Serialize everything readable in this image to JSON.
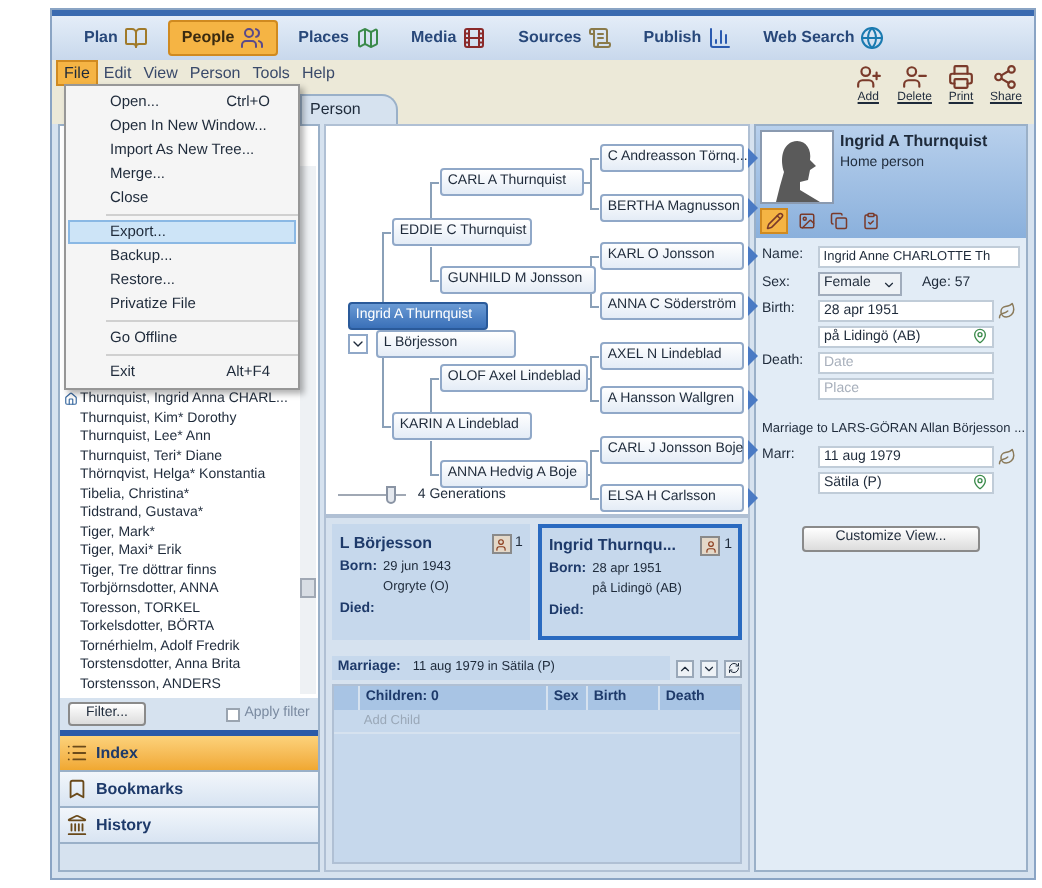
{
  "nav": [
    {
      "label": "Plan",
      "selected": false
    },
    {
      "label": "People",
      "selected": true
    },
    {
      "label": "Places",
      "selected": false
    },
    {
      "label": "Media",
      "selected": false
    },
    {
      "label": "Sources",
      "selected": false
    },
    {
      "label": "Publish",
      "selected": false
    },
    {
      "label": "Web Search",
      "selected": false
    }
  ],
  "menu": [
    {
      "label": "File",
      "selected": true
    },
    {
      "label": "Edit",
      "selected": false
    },
    {
      "label": "View",
      "selected": false
    },
    {
      "label": "Person",
      "selected": false
    },
    {
      "label": "Tools",
      "selected": false
    },
    {
      "label": "Help",
      "selected": false
    }
  ],
  "toolbar": [
    "Add",
    "Delete",
    "Print",
    "Share"
  ],
  "tab": "Person",
  "file_menu": [
    {
      "kind": "item",
      "label": "Open...",
      "shortcut": "Ctrl+O",
      "selected": false
    },
    {
      "kind": "item",
      "label": "Open In New Window...",
      "selected": false
    },
    {
      "kind": "item",
      "label": "Import As New Tree...",
      "selected": false
    },
    {
      "kind": "item",
      "label": "Merge...",
      "selected": false
    },
    {
      "kind": "item",
      "label": "Close",
      "selected": false
    },
    {
      "kind": "separator"
    },
    {
      "kind": "item",
      "label": "Export...",
      "selected": true
    },
    {
      "kind": "item",
      "label": "Backup...",
      "selected": false
    },
    {
      "kind": "item",
      "label": "Restore...",
      "selected": false
    },
    {
      "kind": "item",
      "label": "Privatize File",
      "selected": false
    },
    {
      "kind": "separator"
    },
    {
      "kind": "item",
      "label": "Go Offline",
      "selected": false
    },
    {
      "kind": "separator"
    },
    {
      "kind": "item",
      "label": "Exit",
      "shortcut": "Alt+F4",
      "selected": false
    }
  ],
  "index_list": [
    {
      "name": "Thurnquist, Ingrid Anna CHARL...",
      "home": true
    },
    {
      "name": "Thurnquist, Kim* Dorothy",
      "home": false
    },
    {
      "name": "Thurnquist, Lee* Ann",
      "home": false
    },
    {
      "name": "Thurnquist, Teri* Diane",
      "home": false
    },
    {
      "name": "Thörnqvist, Helga* Konstantia",
      "home": false
    },
    {
      "name": "Tibelia, Christina*",
      "home": false
    },
    {
      "name": "Tidstrand, Gustava*",
      "home": false
    },
    {
      "name": "Tiger, Mark*",
      "home": false
    },
    {
      "name": "Tiger, Maxi* Erik",
      "home": false
    },
    {
      "name": "Tiger, Tre döttrar finns",
      "home": false
    },
    {
      "name": "Torbjörnsdotter, ANNA",
      "home": false
    },
    {
      "name": "Toresson, TORKEL",
      "home": false
    },
    {
      "name": "Torkelsdotter, BÖRTA",
      "home": false
    },
    {
      "name": "Tornérhielm, Adolf Fredrik",
      "home": false
    },
    {
      "name": "Torstensdotter, Anna Brita",
      "home": false
    },
    {
      "name": "Torstensson, ANDERS",
      "home": false
    }
  ],
  "filter_button": "Filter...",
  "apply_filter": {
    "label": "Apply filter",
    "checked": false
  },
  "side_nav": [
    {
      "label": "Index",
      "selected": true
    },
    {
      "label": "Bookmarks",
      "selected": false
    },
    {
      "label": "History",
      "selected": false
    }
  ],
  "tree": {
    "nodes": [
      {
        "name": "CARL A Thurnquist",
        "selected": false
      },
      {
        "name": "EDDIE C Thurnquist",
        "selected": false
      },
      {
        "name": "GUNHILD M Jonsson",
        "selected": false
      },
      {
        "name": "Ingrid A Thurnquist",
        "selected": true
      },
      {
        "name": "L Börjesson",
        "selected": false
      },
      {
        "name": "OLOF Axel Lindeblad",
        "selected": false
      },
      {
        "name": "KARIN A Lindeblad",
        "selected": false
      },
      {
        "name": "ANNA Hedvig A Boje",
        "selected": false
      },
      {
        "name": "C Andreasson Törnq...",
        "selected": false
      },
      {
        "name": "BERTHA Magnusson",
        "selected": false
      },
      {
        "name": "KARL O Jonsson",
        "selected": false
      },
      {
        "name": "ANNA C Söderström",
        "selected": false
      },
      {
        "name": "AXEL N Lindeblad",
        "selected": false
      },
      {
        "name": "A Hansson Wallgren",
        "selected": false
      },
      {
        "name": "CARL J Jonsson Boje",
        "selected": false
      },
      {
        "name": "ELSA H Carlsson",
        "selected": false
      }
    ],
    "generations": {
      "label": "4 Generations",
      "level": 0.8
    }
  },
  "family_cards": [
    {
      "name": "L Börjesson",
      "born_label": "Born:",
      "born_date": "29 jun 1943",
      "born_place": "Orgryte (O)",
      "died_label": "Died:",
      "count": "1",
      "selected": false
    },
    {
      "name": "Ingrid Thurnqu...",
      "born_label": "Born:",
      "born_date": "28 apr 1951",
      "born_place": "på Lidingö (AB)",
      "died_label": "Died:",
      "count": "1",
      "selected": true
    }
  ],
  "marriage": {
    "label": "Marriage:",
    "value": "11 aug 1979 in Sätila (P)"
  },
  "children_table": {
    "columns": [
      "Children: 0",
      "Sex",
      "Birth",
      "Death"
    ],
    "add_row": "Add Child"
  },
  "person": {
    "name": "Ingrid A Thurnquist",
    "subtitle": "Home person",
    "tabs": [
      {
        "selected": true
      },
      {
        "selected": false
      },
      {
        "selected": false
      },
      {
        "selected": false
      }
    ],
    "name_label": "Name:",
    "name_value": "Ingrid Anne CHARLOTTE Th",
    "sex_label": "Sex:",
    "sex_value": "Female",
    "age": "Age: 57",
    "birth_label": "Birth:",
    "birth_date": "28 apr 1951",
    "birth_place": "på Lidingö (AB)",
    "death_label": "Death:",
    "death_date_placeholder": "Date",
    "death_place_placeholder": "Place",
    "marriage_heading": "Marriage to LARS-GÖRAN Allan Börjesson ...",
    "marr_label": "Marr:",
    "marr_date": "11 aug 1979",
    "marr_place": "Sätila (P)",
    "customize_button": "Customize View..."
  }
}
